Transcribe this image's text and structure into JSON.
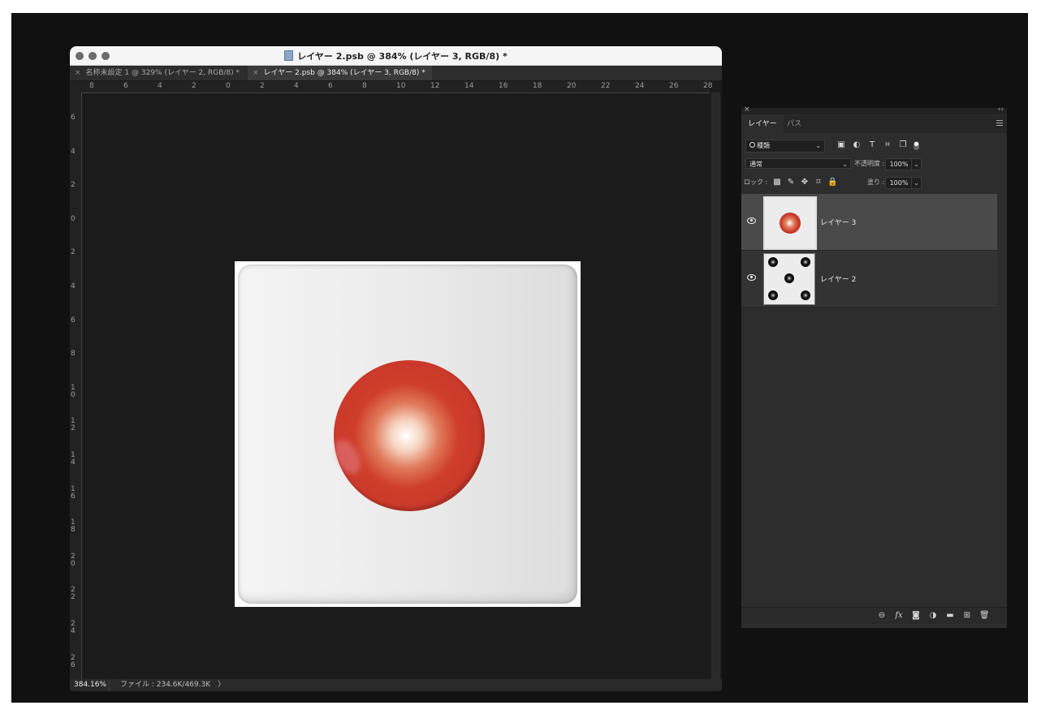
{
  "window": {
    "title": "レイヤー 2.psb @ 384% (レイヤー 3, RGB/8) *",
    "tabs": [
      {
        "label": "名称未設定 1 @ 329% (レイヤー 2, RGB/8) *",
        "active": false
      },
      {
        "label": "レイヤー 2.psb @ 384% (レイヤー 3, RGB/8) *",
        "active": true
      }
    ],
    "tab_close_glyph": "×"
  },
  "ruler": {
    "horizontal": [
      "8",
      "6",
      "4",
      "2",
      "0",
      "2",
      "4",
      "6",
      "8",
      "10",
      "12",
      "14",
      "16",
      "18",
      "20",
      "22",
      "24",
      "26",
      "28"
    ],
    "vertical": [
      "6",
      "4",
      "2",
      "0",
      "2",
      "4",
      "6",
      "8",
      "10",
      "12",
      "14",
      "16",
      "18",
      "20",
      "22",
      "24",
      "26"
    ]
  },
  "status": {
    "zoom": "384.16%",
    "file_info": "ファイル : 234.6K/469.3K",
    "arrow": "〉"
  },
  "layers_panel": {
    "close_glyph": "×",
    "collapse_glyph": "‹‹",
    "tabs": [
      "レイヤー",
      "パス"
    ],
    "filter_label": "種類",
    "filter_chevron": "⌄",
    "filter_icons": [
      "image-filter-icon",
      "adjustment-filter-icon",
      "type-filter-icon",
      "shape-filter-icon",
      "smart-object-filter-icon"
    ],
    "blend_mode": "通常",
    "opacity_label": "不透明度 :",
    "opacity_value": "100%",
    "lock_label": "ロック :",
    "fill_label": "塗り :",
    "fill_value": "100%",
    "dropdown_glyph": "⌄",
    "layers": [
      {
        "name": "レイヤー 3",
        "selected": true,
        "visible": true
      },
      {
        "name": "レイヤー 2",
        "selected": false,
        "visible": true
      }
    ]
  },
  "colors": {
    "dot_red": "#cf3e2a",
    "canvas_bg": "#1b1b1b",
    "panel_bg": "#2d2d2d",
    "selected_layer": "#4a4a4a"
  }
}
